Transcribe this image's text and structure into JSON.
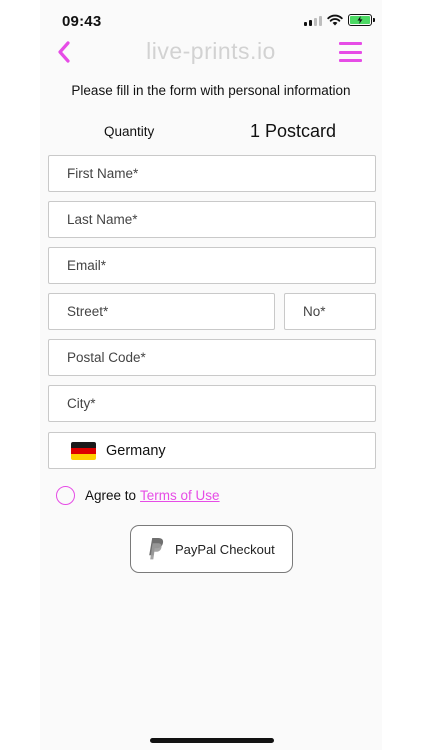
{
  "status_bar": {
    "time": "09:43"
  },
  "header": {
    "brand": "live-prints.io",
    "accent_color": "#e64ce6"
  },
  "instruction": "Please fill in the form with personal information",
  "quantity": {
    "label": "Quantity",
    "value": "1 Postcard"
  },
  "form": {
    "first_name_placeholder": "First Name*",
    "last_name_placeholder": "Last Name*",
    "email_placeholder": "Email*",
    "street_placeholder": "Street*",
    "number_placeholder": "No*",
    "postal_code_placeholder": "Postal Code*",
    "city_placeholder": "City*",
    "country": "Germany",
    "country_flag": "germany-flag-icon"
  },
  "terms": {
    "agree_text": "Agree to",
    "link_text": "Terms of Use"
  },
  "checkout": {
    "label": "PayPal Checkout",
    "icon": "paypal-icon"
  },
  "icons": {
    "back": "chevron-left-icon",
    "menu": "hamburger-menu-icon",
    "signal": "cellular-signal-icon",
    "wifi": "wifi-icon",
    "battery": "battery-charging-icon"
  }
}
